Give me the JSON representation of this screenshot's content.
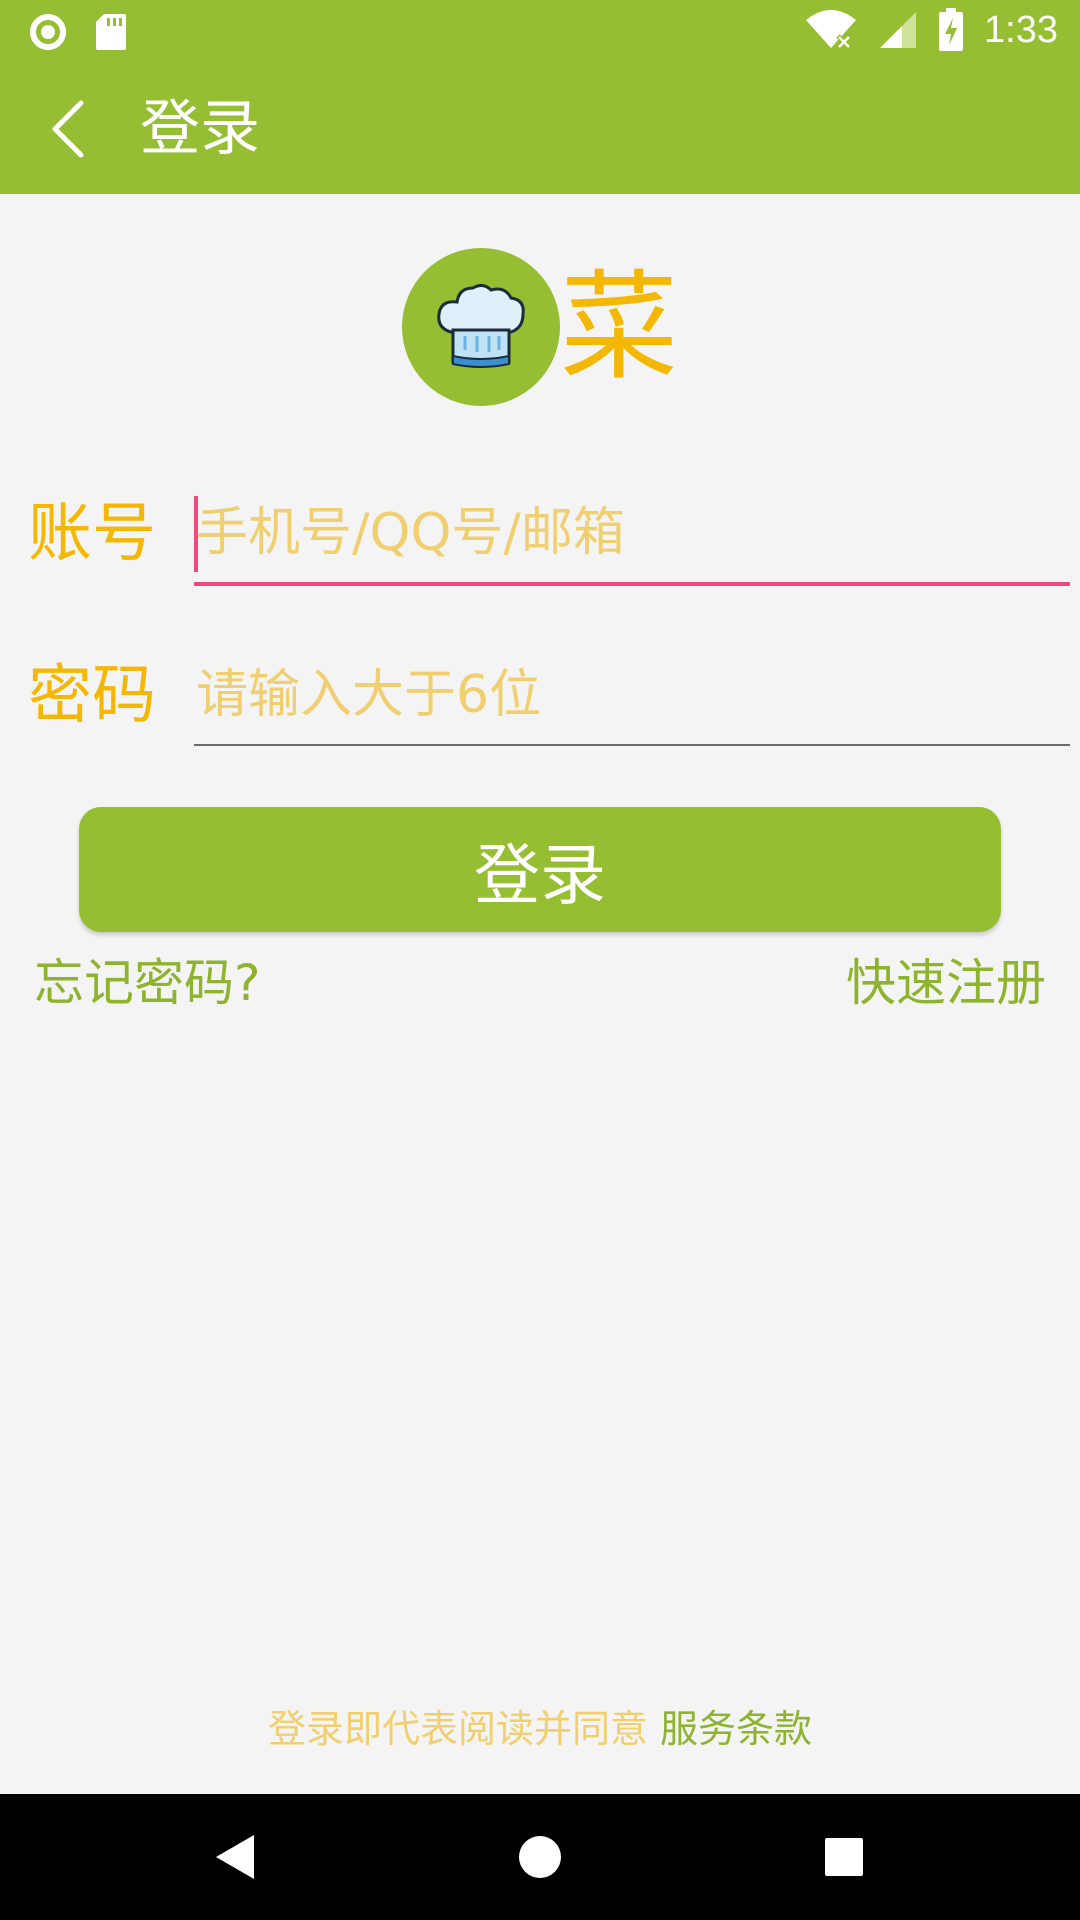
{
  "status_bar": {
    "time": "1:33",
    "icons": [
      "notification-circle-icon",
      "sd-card-icon",
      "wifi-icon",
      "signal-icon",
      "battery-charging-icon"
    ]
  },
  "app_bar": {
    "title": "登录",
    "back_icon": "back-arrow-icon"
  },
  "logo": {
    "icon": "chef-hat-icon",
    "text": "菜",
    "colors": {
      "circle": "#95be33",
      "text": "#f5b705"
    }
  },
  "form": {
    "account": {
      "label": "账号",
      "placeholder": "手机号/QQ号/邮箱",
      "value": ""
    },
    "password": {
      "label": "密码",
      "placeholder": "请输入大于6位",
      "value": ""
    },
    "login_label": "登录",
    "forgot_label": "忘记密码?",
    "register_label": "快速注册"
  },
  "terms": {
    "prefix": "登录即代表阅读并同意 ",
    "link": "服务条款"
  },
  "nav_bar": {
    "icons": [
      "nav-back-icon",
      "nav-home-icon",
      "nav-recents-icon"
    ]
  },
  "colors": {
    "primary_green": "#95be33",
    "accent_yellow": "#f5b705",
    "placeholder_yellow": "#f0cf70",
    "focus_pink": "#f0487f"
  }
}
